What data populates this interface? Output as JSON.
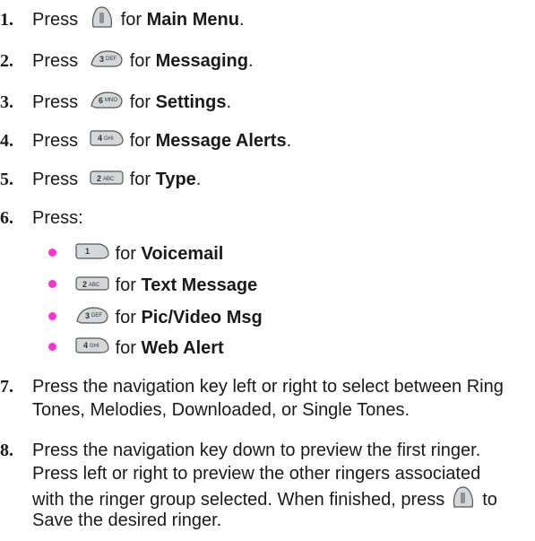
{
  "steps": [
    {
      "num": "1.",
      "pre": "Press",
      "key": "menu-ok-key-icon",
      "post": "for",
      "bold": "Main Menu",
      "end": "."
    },
    {
      "num": "2.",
      "pre": "Press",
      "key": "3-def-key-icon",
      "post": "for",
      "bold": "Messaging",
      "end": "."
    },
    {
      "num": "3.",
      "pre": "Press",
      "key": "6-mno-key-icon",
      "post": "for",
      "bold": "Settings",
      "end": "."
    },
    {
      "num": "4.",
      "pre": "Press",
      "key": "4-ghi-key-icon",
      "post": "for",
      "bold": "Message Alerts",
      "end": "."
    },
    {
      "num": "5.",
      "pre": "Press",
      "key": "2-abc-key-icon",
      "post": "for",
      "bold": "Type",
      "end": "."
    },
    {
      "num": "6.",
      "pre": "Press:"
    }
  ],
  "bullets": [
    {
      "key": "1-key-icon",
      "post": "for",
      "bold": "Voicemail"
    },
    {
      "key": "2-abc-key-icon",
      "post": "for",
      "bold": "Text Message"
    },
    {
      "key": "3-def-key-icon",
      "post": "for",
      "bold": "Pic/Video Msg"
    },
    {
      "key": "4-ghi-key-icon",
      "post": "for",
      "bold": "Web Alert"
    }
  ],
  "step7": {
    "num": "7.",
    "lines": [
      "Press the navigation key left or right to select between Ring",
      "Tones, Melodies, Downloaded, or Single Tones."
    ]
  },
  "step8": {
    "num": "8.",
    "lines": [
      "Press the navigation key down to preview the first ringer.",
      "Press left or right to preview the other ringers associated"
    ],
    "line3_pre": "with the ringer group selected. When finished, press",
    "line3_key": "menu-ok-key-icon",
    "line3_post": "to",
    "line4": "Save the desired ringer."
  },
  "colors": {
    "bullet": "#ff2fd6",
    "key_fill": "#cfd4d8",
    "key_edge": "#5a5f63"
  }
}
